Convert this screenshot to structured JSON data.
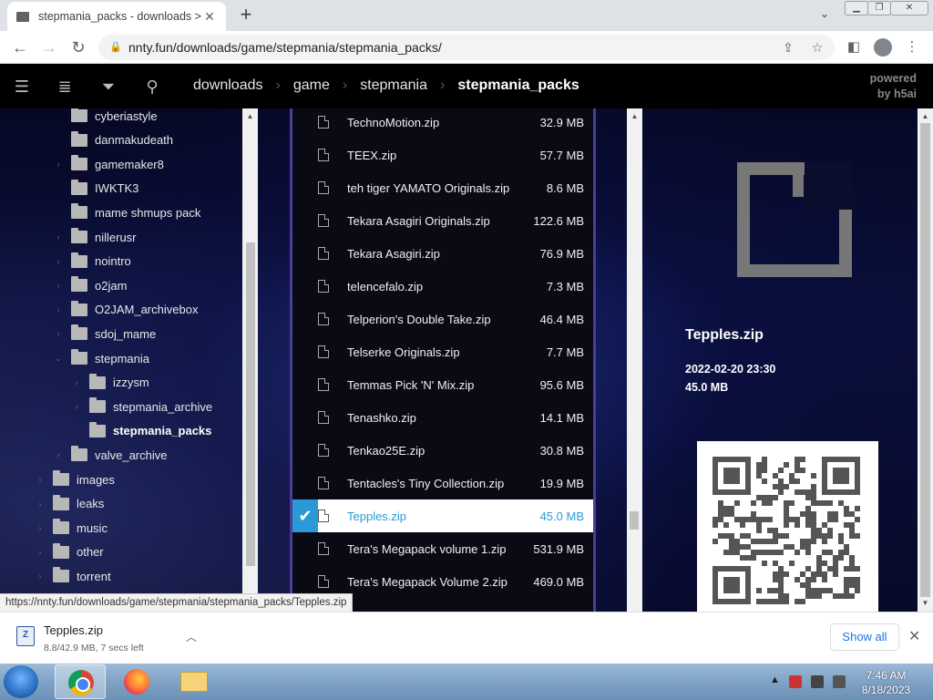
{
  "browser": {
    "tab_title": "stepmania_packs - downloads > ",
    "tab_close": "✕",
    "new_tab": "+",
    "url": "nnty.fun/downloads/game/stepmania/stepmania_packs/"
  },
  "site": {
    "breadcrumbs": [
      "downloads",
      "game",
      "stepmania",
      "stepmania_packs"
    ],
    "powered_line1": "powered",
    "powered_line2": "by h5ai"
  },
  "tree": [
    {
      "label": "cyberiastyle",
      "depth": 1,
      "arrow": "",
      "active": false
    },
    {
      "label": "danmakudeath",
      "depth": 1,
      "arrow": "",
      "active": false
    },
    {
      "label": "gamemaker8",
      "depth": 1,
      "arrow": "›",
      "active": false
    },
    {
      "label": "IWKTK3",
      "depth": 1,
      "arrow": "",
      "active": false
    },
    {
      "label": "mame shmups pack",
      "depth": 1,
      "arrow": "",
      "active": false
    },
    {
      "label": "nillerusr",
      "depth": 1,
      "arrow": "›",
      "active": false
    },
    {
      "label": "nointro",
      "depth": 1,
      "arrow": "›",
      "active": false
    },
    {
      "label": "o2jam",
      "depth": 1,
      "arrow": "›",
      "active": false
    },
    {
      "label": "O2JAM_archivebox",
      "depth": 1,
      "arrow": "›",
      "active": false
    },
    {
      "label": "sdoj_mame",
      "depth": 1,
      "arrow": "›",
      "active": false
    },
    {
      "label": "stepmania",
      "depth": 1,
      "arrow": "⌄",
      "active": false
    },
    {
      "label": "izzysm",
      "depth": 2,
      "arrow": "›",
      "active": false
    },
    {
      "label": "stepmania_archive",
      "depth": 2,
      "arrow": "›",
      "active": false
    },
    {
      "label": "stepmania_packs",
      "depth": 2,
      "arrow": "",
      "active": true
    },
    {
      "label": "valve_archive",
      "depth": 1,
      "arrow": "›",
      "active": false
    },
    {
      "label": "images",
      "depth": 0,
      "arrow": "›",
      "active": false
    },
    {
      "label": "leaks",
      "depth": 0,
      "arrow": "›",
      "active": false
    },
    {
      "label": "music",
      "depth": 0,
      "arrow": "›",
      "active": false
    },
    {
      "label": "other",
      "depth": 0,
      "arrow": "›",
      "active": false
    },
    {
      "label": "torrent",
      "depth": 0,
      "arrow": "›",
      "active": false
    }
  ],
  "files": [
    {
      "name": "TechnoMotion.zip",
      "size": "32.9 MB",
      "selected": false
    },
    {
      "name": "TEEX.zip",
      "size": "57.7 MB",
      "selected": false
    },
    {
      "name": "teh tiger YAMATO Originals.zip",
      "size": "8.6 MB",
      "selected": false
    },
    {
      "name": "Tekara Asagiri Originals.zip",
      "size": "122.6 MB",
      "selected": false
    },
    {
      "name": "Tekara Asagiri.zip",
      "size": "76.9 MB",
      "selected": false
    },
    {
      "name": "telencefalo.zip",
      "size": "7.3 MB",
      "selected": false
    },
    {
      "name": "Telperion's Double Take.zip",
      "size": "46.4 MB",
      "selected": false
    },
    {
      "name": "Telserke Originals.zip",
      "size": "7.7 MB",
      "selected": false
    },
    {
      "name": "Temmas Pick 'N' Mix.zip",
      "size": "95.6 MB",
      "selected": false
    },
    {
      "name": "Tenashko.zip",
      "size": "14.1 MB",
      "selected": false
    },
    {
      "name": "Tenkao25E.zip",
      "size": "30.8 MB",
      "selected": false
    },
    {
      "name": "Tentacles's Tiny Collection.zip",
      "size": "19.9 MB",
      "selected": false
    },
    {
      "name": "Tepples.zip",
      "size": "45.0 MB",
      "selected": true
    },
    {
      "name": "Tera's Megapack volume 1.zip",
      "size": "531.9 MB",
      "selected": false
    },
    {
      "name": "Tera's Megapack Volume 2.zip",
      "size": "469.0 MB",
      "selected": false
    }
  ],
  "info": {
    "name": "Tepples.zip",
    "date": "2022-02-20 23:30",
    "size": "45.0 MB"
  },
  "status_url": "https://nnty.fun/downloads/game/stepmania/stepmania_packs/Tepples.zip",
  "download": {
    "name": "Tepples.zip",
    "progress": "8.8/42.9 MB, 7 secs left",
    "show_all": "Show all"
  },
  "taskbar": {
    "time": "7:46 AM",
    "date": "8/18/2023"
  }
}
